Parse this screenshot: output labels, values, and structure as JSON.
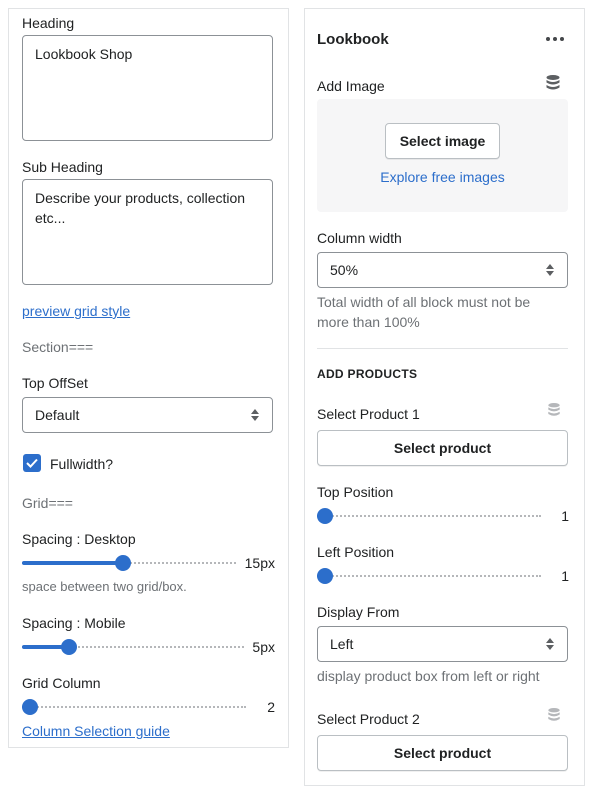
{
  "colors": {
    "accent": "#2c6ecb",
    "border": "#8c9196",
    "muted": "#6d7175",
    "dropzone_bg": "#f6f6f7"
  },
  "left": {
    "heading": {
      "label": "Heading",
      "value": "Lookbook Shop"
    },
    "sub_heading": {
      "label": "Sub Heading",
      "value": "Describe your products, collection etc..."
    },
    "preview_link": "preview grid style",
    "section_marker": "Section===",
    "top_offset": {
      "label": "Top OffSet",
      "selected": "Default"
    },
    "fullwidth": {
      "label": "Fullwidth?",
      "checked": true
    },
    "grid_marker": "Grid===",
    "spacing_desktop": {
      "label": "Spacing : Desktop",
      "value": 15,
      "display": "15px",
      "fill_fraction": 0.47,
      "help": "space between two grid/box."
    },
    "spacing_mobile": {
      "label": "Spacing : Mobile",
      "value": 5,
      "display": "5px",
      "fill_fraction": 0.19
    },
    "grid_column": {
      "label": "Grid Column",
      "value": 2,
      "display": "2",
      "fill_fraction": 0.0
    },
    "column_guide_link": "Column Selection guide"
  },
  "right": {
    "block_title": "Lookbook",
    "more_icon": "more-horizontal-icon",
    "add_image": {
      "label": "Add Image",
      "icon": "database-icon",
      "button": "Select image",
      "explore_link": "Explore free images"
    },
    "column_width": {
      "label": "Column width",
      "selected": "50%",
      "help": "Total width of all block must not be more than 100%"
    },
    "add_products_title": "ADD PRODUCTS",
    "product1": {
      "label": "Select Product 1",
      "icon": "database-icon",
      "button": "Select product"
    },
    "top_position": {
      "label": "Top Position",
      "value": 1,
      "display": "1",
      "fill_fraction": 0.0
    },
    "left_position": {
      "label": "Left Position",
      "value": 1,
      "display": "1",
      "fill_fraction": 0.0
    },
    "display_from": {
      "label": "Display From",
      "selected": "Left",
      "help": "display product box from left or right"
    },
    "product2": {
      "label": "Select Product 2",
      "icon": "database-icon",
      "button": "Select product"
    }
  }
}
